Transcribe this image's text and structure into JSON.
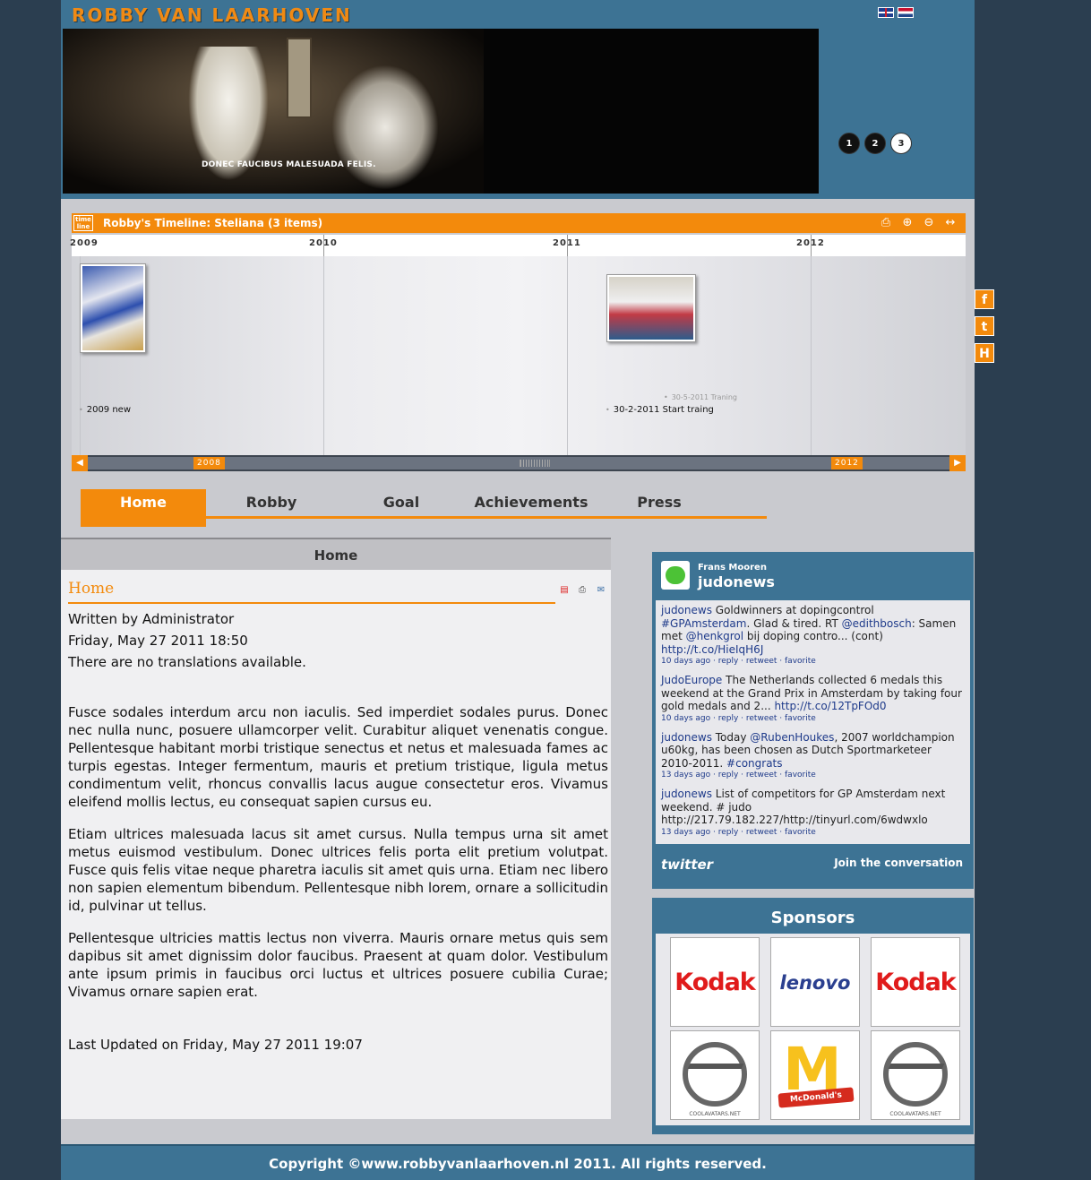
{
  "site": {
    "title": "ROBBY VAN LAARHOVEN",
    "flags": [
      "en",
      "nl"
    ]
  },
  "banner": {
    "caption": "DONEC FAUCIBUS MALESUADA FELIS.",
    "slides": [
      "1",
      "2",
      "3"
    ],
    "active_slide": 3
  },
  "timeline": {
    "logo": "time line",
    "title": "Robby's Timeline: Steliana  (3 items)",
    "tools": [
      "print-icon",
      "zoom-in-icon",
      "zoom-out-icon",
      "fit-icon"
    ],
    "years": [
      "2009",
      "2010",
      "2011",
      "2012"
    ],
    "events": [
      {
        "label": "2009 new"
      },
      {
        "label": "30-5-2011 Traning"
      },
      {
        "label": "30-2-2011 Start traing"
      }
    ],
    "range_start": "2008",
    "range_end": "2012"
  },
  "nav": {
    "items": [
      "Home",
      "Robby",
      "Goal",
      "Achievements",
      "Press"
    ],
    "active": "Home"
  },
  "content": {
    "section_title": "Home",
    "article_title": "Home",
    "author": "Written by Administrator",
    "date": "Friday, May 27 2011 18:50",
    "no_translation": "There are no translations available.",
    "paragraphs": [
      "Fusce sodales interdum arcu non iaculis. Sed imperdiet sodales purus. Donec nec nulla nunc, posuere ullamcorper velit. Curabitur aliquet venenatis congue. Pellentesque habitant morbi tristique senectus et netus et malesuada fames ac turpis egestas. Integer fermentum, mauris et pretium tristique, ligula metus condimentum velit, rhoncus convallis lacus augue consectetur eros. Vivamus eleifend mollis lectus, eu consequat sapien cursus eu.",
      "Etiam ultrices malesuada lacus sit amet cursus. Nulla tempus urna sit amet metus euismod vestibulum. Donec ultrices felis porta elit pretium volutpat. Fusce quis felis vitae neque pharetra iaculis sit amet quis urna. Etiam nec libero non sapien elementum bibendum. Pellentesque nibh lorem, ornare a sollicitudin id, pulvinar ut tellus.",
      "Pellentesque ultricies mattis lectus non viverra. Mauris ornare metus quis sem dapibus sit amet dignissim dolor faucibus. Praesent at quam dolor. Vestibulum ante ipsum primis in faucibus orci luctus et ultrices posuere cubilia Curae; Vivamus ornare sapien erat."
    ],
    "last_updated": "Last Updated on Friday, May 27 2011 19:07"
  },
  "social": {
    "icons": [
      "facebook-icon",
      "twitter-icon",
      "hyves-icon"
    ]
  },
  "twitter": {
    "name": "Frans Mooren",
    "handle": "judonews",
    "tweets": [
      {
        "user": "judonews",
        "text": " Goldwinners at dopingcontrol ",
        "tag": "#GPAmsterdam",
        "text2": ". Glad & tired. RT ",
        "mention": "@edithbosch",
        "text3": ": Samen met ",
        "mention2": "@henkgrol",
        "text4": " bij doping contro... (cont) ",
        "link": "http://t.co/HieIqH6J",
        "time": "10 days ago · reply · retweet · favorite"
      },
      {
        "user": "JudoEurope",
        "text": " The Netherlands collected 6 medals this weekend at the Grand Prix in Amsterdam by taking four gold medals and 2... ",
        "link": "http://t.co/12TpFOd0",
        "time": "10 days ago · reply · retweet · favorite"
      },
      {
        "user": "judonews",
        "text": " Today ",
        "mention": "@RubenHoukes",
        "text2": ", 2007 worldchampion u60kg, has been chosen as Dutch Sportmarketeer 2010-2011. ",
        "tag": "#congrats",
        "time": "13 days ago · reply · retweet · favorite"
      },
      {
        "user": "judonews",
        "text": " List of competitors for GP Amsterdam next weekend. # judo http://217.79.182.227/http://tinyurl.com/6wdwxlo",
        "time": "13 days ago · reply · retweet · favorite"
      }
    ],
    "footer_logo": "twitter",
    "join": "Join the conversation"
  },
  "sponsors": {
    "title": "Sponsors",
    "items": [
      "Kodak",
      "lenovo",
      "Kodak",
      "COOLAVATARS.NET",
      "McDonald's",
      "COOLAVATARS.NET"
    ]
  },
  "footer": {
    "copyright": "Copyright ©www.robbyvanlaarhoven.nl 2011. All rights reserved."
  }
}
